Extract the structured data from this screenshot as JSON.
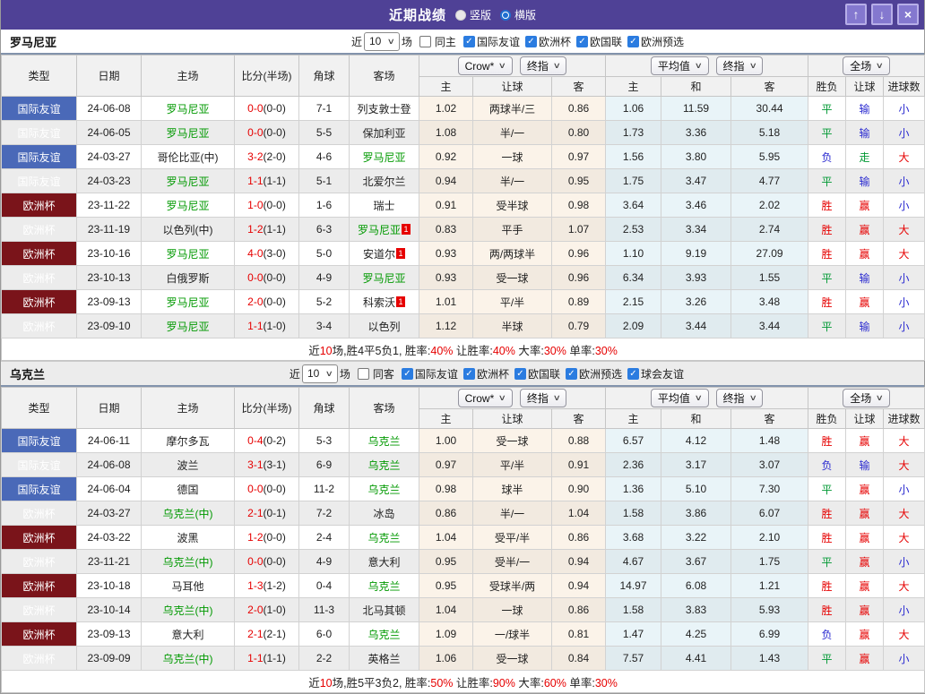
{
  "titlebar": {
    "title": "近期战绩",
    "vertical_label": "竖版",
    "horizontal_label": "横版",
    "vertical_checked": false,
    "horizontal_checked": true,
    "buttons": {
      "up": "↑",
      "down": "↓",
      "close": "×"
    }
  },
  "colors": {
    "accent_purple": "#4f4196",
    "type_friendly_blue": "#4a69b8",
    "type_eurocup_maroon": "#7a141a",
    "team_green": "#009900",
    "score_red": "#e60000",
    "result_red": "#e60000",
    "result_green": "#009933",
    "result_blue": "#2a2ad0"
  },
  "table_labels": {
    "left_columns": [
      "类型",
      "日期",
      "主场",
      "比分(半场)",
      "角球",
      "客场"
    ],
    "crow_select": "Crow*",
    "crow_final_select": "终指",
    "crow_sub": [
      "主",
      "让球",
      "客"
    ],
    "avg_select": "平均值",
    "avg_final_select": "终指",
    "avg_sub": [
      "主",
      "和",
      "客"
    ],
    "full_select": "全场",
    "full_sub": [
      "胜负",
      "让球",
      "进球数"
    ]
  },
  "sections": [
    {
      "team": "罗马尼亚",
      "header_gray": false,
      "filter": {
        "prefix": "近",
        "count": "10",
        "suffix": "场",
        "same_label": "同主",
        "same_checked": false,
        "leagues": [
          {
            "label": "国际友谊",
            "checked": true
          },
          {
            "label": "欧洲杯",
            "checked": true
          },
          {
            "label": "欧国联",
            "checked": true
          },
          {
            "label": "欧洲预选",
            "checked": true
          }
        ]
      },
      "rows": [
        {
          "type": "国际友谊",
          "date": "24-06-08",
          "home": "罗马尼亚",
          "hg": true,
          "score": "0-0",
          "half": "(0-0)",
          "corner": "7-1",
          "away": "列支敦士登",
          "ag": false,
          "sup": "",
          "crow": [
            "1.02",
            "两球半/三",
            "0.86"
          ],
          "avg": [
            "1.06",
            "11.59",
            "30.44"
          ],
          "res": [
            "平",
            "输",
            "小"
          ]
        },
        {
          "type": "国际友谊",
          "date": "24-06-05",
          "home": "罗马尼亚",
          "hg": true,
          "score": "0-0",
          "half": "(0-0)",
          "corner": "5-5",
          "away": "保加利亚",
          "ag": false,
          "sup": "",
          "crow": [
            "1.08",
            "半/一",
            "0.80"
          ],
          "avg": [
            "1.73",
            "3.36",
            "5.18"
          ],
          "res": [
            "平",
            "输",
            "小"
          ]
        },
        {
          "type": "国际友谊",
          "date": "24-03-27",
          "home": "哥伦比亚(中)",
          "hg": false,
          "score": "3-2",
          "half": "(2-0)",
          "corner": "4-6",
          "away": "罗马尼亚",
          "ag": true,
          "sup": "",
          "crow": [
            "0.92",
            "一球",
            "0.97"
          ],
          "avg": [
            "1.56",
            "3.80",
            "5.95"
          ],
          "res": [
            "负",
            "走",
            "大"
          ]
        },
        {
          "type": "国际友谊",
          "date": "24-03-23",
          "home": "罗马尼亚",
          "hg": true,
          "score": "1-1",
          "half": "(1-1)",
          "corner": "5-1",
          "away": "北爱尔兰",
          "ag": false,
          "sup": "",
          "crow": [
            "0.94",
            "半/一",
            "0.95"
          ],
          "avg": [
            "1.75",
            "3.47",
            "4.77"
          ],
          "res": [
            "平",
            "输",
            "小"
          ]
        },
        {
          "type": "欧洲杯",
          "date": "23-11-22",
          "home": "罗马尼亚",
          "hg": true,
          "score": "1-0",
          "half": "(0-0)",
          "corner": "1-6",
          "away": "瑞士",
          "ag": false,
          "sup": "",
          "crow": [
            "0.91",
            "受半球",
            "0.98"
          ],
          "avg": [
            "3.64",
            "3.46",
            "2.02"
          ],
          "res": [
            "胜",
            "赢",
            "小"
          ]
        },
        {
          "type": "欧洲杯",
          "date": "23-11-19",
          "home": "以色列(中)",
          "hg": false,
          "score": "1-2",
          "half": "(1-1)",
          "corner": "6-3",
          "away": "罗马尼亚",
          "ag": true,
          "sup": "1",
          "crow": [
            "0.83",
            "平手",
            "1.07"
          ],
          "avg": [
            "2.53",
            "3.34",
            "2.74"
          ],
          "res": [
            "胜",
            "赢",
            "大"
          ]
        },
        {
          "type": "欧洲杯",
          "date": "23-10-16",
          "home": "罗马尼亚",
          "hg": true,
          "score": "4-0",
          "half": "(3-0)",
          "corner": "5-0",
          "away": "安道尔",
          "ag": false,
          "sup": "1",
          "crow": [
            "0.93",
            "两/两球半",
            "0.96"
          ],
          "avg": [
            "1.10",
            "9.19",
            "27.09"
          ],
          "res": [
            "胜",
            "赢",
            "大"
          ]
        },
        {
          "type": "欧洲杯",
          "date": "23-10-13",
          "home": "白俄罗斯",
          "hg": false,
          "score": "0-0",
          "half": "(0-0)",
          "corner": "4-9",
          "away": "罗马尼亚",
          "ag": true,
          "sup": "",
          "crow": [
            "0.93",
            "受一球",
            "0.96"
          ],
          "avg": [
            "6.34",
            "3.93",
            "1.55"
          ],
          "res": [
            "平",
            "输",
            "小"
          ]
        },
        {
          "type": "欧洲杯",
          "date": "23-09-13",
          "home": "罗马尼亚",
          "hg": true,
          "score": "2-0",
          "half": "(0-0)",
          "corner": "5-2",
          "away": "科索沃",
          "ag": false,
          "sup": "1",
          "crow": [
            "1.01",
            "平/半",
            "0.89"
          ],
          "avg": [
            "2.15",
            "3.26",
            "3.48"
          ],
          "res": [
            "胜",
            "赢",
            "小"
          ]
        },
        {
          "type": "欧洲杯",
          "date": "23-09-10",
          "home": "罗马尼亚",
          "hg": true,
          "score": "1-1",
          "half": "(1-0)",
          "corner": "3-4",
          "away": "以色列",
          "ag": false,
          "sup": "",
          "crow": [
            "1.12",
            "半球",
            "0.79"
          ],
          "avg": [
            "2.09",
            "3.44",
            "3.44"
          ],
          "res": [
            "平",
            "输",
            "小"
          ]
        }
      ],
      "summary": [
        {
          "t": "近"
        },
        {
          "t": "10",
          "red": true
        },
        {
          "t": "场,胜4平5负1, 胜率:"
        },
        {
          "t": "40%",
          "red": true
        },
        {
          "t": " 让胜率:"
        },
        {
          "t": "40%",
          "red": true
        },
        {
          "t": " 大率:"
        },
        {
          "t": "30%",
          "red": true
        },
        {
          "t": " 单率:"
        },
        {
          "t": "30%",
          "red": true
        }
      ]
    },
    {
      "team": "乌克兰",
      "header_gray": true,
      "filter": {
        "prefix": "近",
        "count": "10",
        "suffix": "场",
        "same_label": "同客",
        "same_checked": false,
        "leagues": [
          {
            "label": "国际友谊",
            "checked": true
          },
          {
            "label": "欧洲杯",
            "checked": true
          },
          {
            "label": "欧国联",
            "checked": true
          },
          {
            "label": "欧洲预选",
            "checked": true
          },
          {
            "label": "球会友谊",
            "checked": true
          }
        ]
      },
      "rows": [
        {
          "type": "国际友谊",
          "date": "24-06-11",
          "home": "摩尔多瓦",
          "hg": false,
          "score": "0-4",
          "half": "(0-2)",
          "corner": "5-3",
          "away": "乌克兰",
          "ag": true,
          "sup": "",
          "crow": [
            "1.00",
            "受一球",
            "0.88"
          ],
          "avg": [
            "6.57",
            "4.12",
            "1.48"
          ],
          "res": [
            "胜",
            "赢",
            "大"
          ]
        },
        {
          "type": "国际友谊",
          "date": "24-06-08",
          "home": "波兰",
          "hg": false,
          "score": "3-1",
          "half": "(3-1)",
          "corner": "6-9",
          "away": "乌克兰",
          "ag": true,
          "sup": "",
          "crow": [
            "0.97",
            "平/半",
            "0.91"
          ],
          "avg": [
            "2.36",
            "3.17",
            "3.07"
          ],
          "res": [
            "负",
            "输",
            "大"
          ]
        },
        {
          "type": "国际友谊",
          "date": "24-06-04",
          "home": "德国",
          "hg": false,
          "score": "0-0",
          "half": "(0-0)",
          "corner": "11-2",
          "away": "乌克兰",
          "ag": true,
          "sup": "",
          "crow": [
            "0.98",
            "球半",
            "0.90"
          ],
          "avg": [
            "1.36",
            "5.10",
            "7.30"
          ],
          "res": [
            "平",
            "赢",
            "小"
          ]
        },
        {
          "type": "欧洲杯",
          "date": "24-03-27",
          "home": "乌克兰(中)",
          "hg": true,
          "score": "2-1",
          "half": "(0-1)",
          "corner": "7-2",
          "away": "冰岛",
          "ag": false,
          "sup": "",
          "crow": [
            "0.86",
            "半/一",
            "1.04"
          ],
          "avg": [
            "1.58",
            "3.86",
            "6.07"
          ],
          "res": [
            "胜",
            "赢",
            "大"
          ]
        },
        {
          "type": "欧洲杯",
          "date": "24-03-22",
          "home": "波黑",
          "hg": false,
          "score": "1-2",
          "half": "(0-0)",
          "corner": "2-4",
          "away": "乌克兰",
          "ag": true,
          "sup": "",
          "crow": [
            "1.04",
            "受平/半",
            "0.86"
          ],
          "avg": [
            "3.68",
            "3.22",
            "2.10"
          ],
          "res": [
            "胜",
            "赢",
            "大"
          ]
        },
        {
          "type": "欧洲杯",
          "date": "23-11-21",
          "home": "乌克兰(中)",
          "hg": true,
          "score": "0-0",
          "half": "(0-0)",
          "corner": "4-9",
          "away": "意大利",
          "ag": false,
          "sup": "",
          "crow": [
            "0.95",
            "受半/一",
            "0.94"
          ],
          "avg": [
            "4.67",
            "3.67",
            "1.75"
          ],
          "res": [
            "平",
            "赢",
            "小"
          ]
        },
        {
          "type": "欧洲杯",
          "date": "23-10-18",
          "home": "马耳他",
          "hg": false,
          "score": "1-3",
          "half": "(1-2)",
          "corner": "0-4",
          "away": "乌克兰",
          "ag": true,
          "sup": "",
          "crow": [
            "0.95",
            "受球半/两",
            "0.94"
          ],
          "avg": [
            "14.97",
            "6.08",
            "1.21"
          ],
          "res": [
            "胜",
            "赢",
            "大"
          ]
        },
        {
          "type": "欧洲杯",
          "date": "23-10-14",
          "home": "乌克兰(中)",
          "hg": true,
          "score": "2-0",
          "half": "(1-0)",
          "corner": "11-3",
          "away": "北马其顿",
          "ag": false,
          "sup": "",
          "crow": [
            "1.04",
            "一球",
            "0.86"
          ],
          "avg": [
            "1.58",
            "3.83",
            "5.93"
          ],
          "res": [
            "胜",
            "赢",
            "小"
          ]
        },
        {
          "type": "欧洲杯",
          "date": "23-09-13",
          "home": "意大利",
          "hg": false,
          "score": "2-1",
          "half": "(2-1)",
          "corner": "6-0",
          "away": "乌克兰",
          "ag": true,
          "sup": "",
          "crow": [
            "1.09",
            "一/球半",
            "0.81"
          ],
          "avg": [
            "1.47",
            "4.25",
            "6.99"
          ],
          "res": [
            "负",
            "赢",
            "大"
          ]
        },
        {
          "type": "欧洲杯",
          "date": "23-09-09",
          "home": "乌克兰(中)",
          "hg": true,
          "score": "1-1",
          "half": "(1-1)",
          "corner": "2-2",
          "away": "英格兰",
          "ag": false,
          "sup": "",
          "crow": [
            "1.06",
            "受一球",
            "0.84"
          ],
          "avg": [
            "7.57",
            "4.41",
            "1.43"
          ],
          "res": [
            "平",
            "赢",
            "小"
          ]
        }
      ],
      "summary": [
        {
          "t": "近"
        },
        {
          "t": "10",
          "red": true
        },
        {
          "t": "场,胜5平3负2, 胜率:"
        },
        {
          "t": "50%",
          "red": true
        },
        {
          "t": " 让胜率:"
        },
        {
          "t": "90%",
          "red": true
        },
        {
          "t": " 大率:"
        },
        {
          "t": "60%",
          "red": true
        },
        {
          "t": " 单率:"
        },
        {
          "t": "30%",
          "red": true
        }
      ]
    }
  ]
}
